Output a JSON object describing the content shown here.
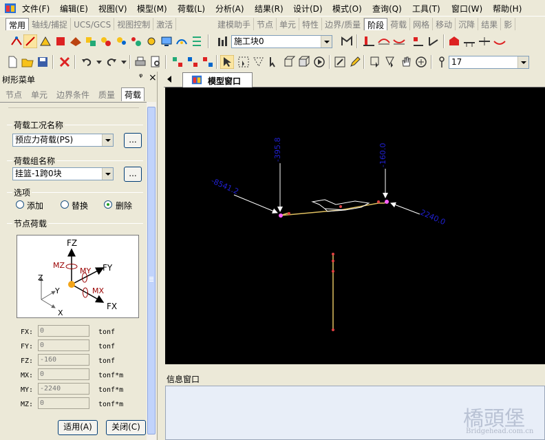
{
  "menu": [
    "文件(F)",
    "编辑(E)",
    "视图(V)",
    "模型(M)",
    "荷载(L)",
    "分析(A)",
    "结果(R)",
    "设计(D)",
    "模式(O)",
    "查询(Q)",
    "工具(T)",
    "窗口(W)",
    "帮助(H)"
  ],
  "tabs_left": [
    "常用",
    "轴线/捕捉",
    "UCS/GCS",
    "视图控制",
    "激活"
  ],
  "tabs_right": [
    "建模助手",
    "节点",
    "单元",
    "特性",
    "边界/质量",
    "阶段",
    "荷载",
    "网格",
    "移动",
    "沉降",
    "结果",
    "影"
  ],
  "stage_combo": "施工块0",
  "number_combo": "17",
  "panel": {
    "title": "树形菜单",
    "pin": "ᵠ",
    "close": "×",
    "tabs": [
      "节点",
      "单元",
      "边界条件",
      "质量",
      "荷载"
    ],
    "load_case_label": "荷载工况名称",
    "load_case_value": "预应力荷载(PS)",
    "load_group_label": "荷载组名称",
    "load_group_value": "挂篮-1跨0块",
    "dots": "...",
    "options_label": "选项",
    "opt_add": "添加",
    "opt_replace": "替换",
    "opt_delete": "删除",
    "node_load_label": "节点荷载",
    "diagram": {
      "fz": "FZ",
      "mz": "MZ",
      "my": "MY",
      "fy": "FY",
      "mx": "MX",
      "fx": "FX",
      "z": "Z",
      "y": "Y",
      "x": "X"
    },
    "fields": [
      {
        "label": "FX:",
        "value": "0",
        "unit": "tonf"
      },
      {
        "label": "FY:",
        "value": "0",
        "unit": "tonf"
      },
      {
        "label": "FZ:",
        "value": "-160",
        "unit": "tonf"
      },
      {
        "label": "MX:",
        "value": "0",
        "unit": "tonf*m"
      },
      {
        "label": "MY:",
        "value": "-2240",
        "unit": "tonf*m"
      },
      {
        "label": "MZ:",
        "value": "0",
        "unit": "tonf*m"
      }
    ],
    "apply_button": "适用(A)",
    "close_button": "关闭(C)"
  },
  "doc_tab": "模型窗口",
  "viewport_labels": {
    "load_top_left": "-395.8",
    "load_left": "-8541.2",
    "load_top_right": "-160.0",
    "load_right": "2240.0"
  },
  "info_window_title": "信息窗口",
  "watermark": {
    "main": "橋頭堡",
    "sub": "Bridgehead.com.cn"
  }
}
